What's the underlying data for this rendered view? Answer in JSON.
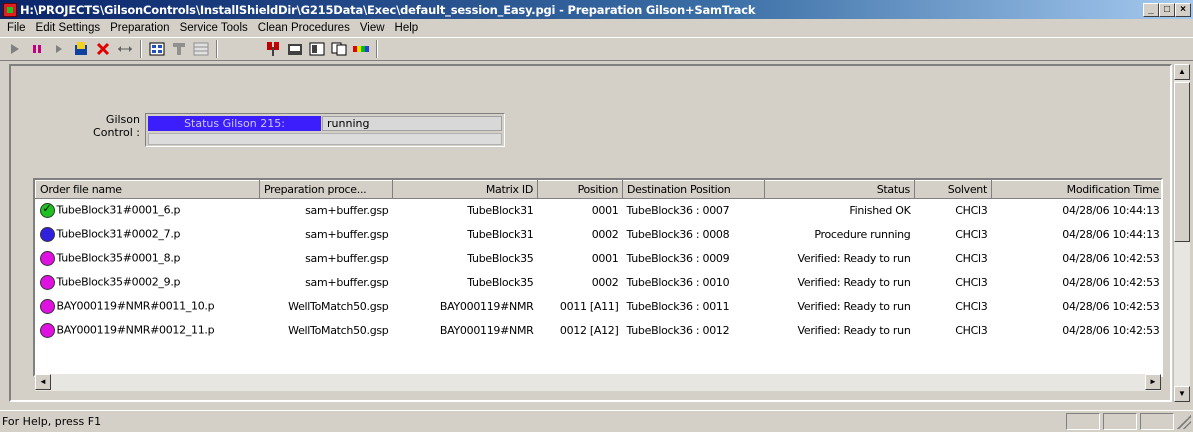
{
  "window": {
    "title": "H:\\PROJECTS\\GilsonControls\\InstallShieldDir\\G215Data\\Exec\\default_session_Easy.pgi - Preparation Gilson+SamTrack",
    "minimize": "_",
    "maximize": "□",
    "close": "×"
  },
  "menu": [
    "File",
    "Edit Settings",
    "Preparation",
    "Service Tools",
    "Clean Procedures",
    "View",
    "Help"
  ],
  "toolbar": {
    "icons": [
      "play-icon",
      "pause-icon",
      "step-icon",
      "save-icon",
      "stop-icon",
      "swap-icon",
      "grid-icon",
      "filter-icon",
      "table-icon",
      "connect-icon",
      "device-icon",
      "panel-icon",
      "copy-icon",
      "color-bar-icon"
    ],
    "colors": {
      "play": "#808080",
      "pause": "#c00080",
      "stop": "#e00000"
    }
  },
  "gilson": {
    "label": "Gilson Control :",
    "status_label": "Status Gilson 215:",
    "status_value": "running",
    "status_color": "#3c1efc"
  },
  "table": {
    "columns": [
      "Order file name",
      "Preparation proce...",
      "Matrix ID",
      "Position",
      "Destination Position",
      "Status",
      "Solvent",
      "Modification Time"
    ],
    "rows": [
      {
        "name": "TubeBlock31#0001_6.p",
        "proc": "sam+buffer.gsp",
        "matrix": "TubeBlock31",
        "pos": "0001",
        "dest": "TubeBlock36 : 0007",
        "status": "Finished OK",
        "solvent": "CHCl3",
        "time": "04/28/06 10:44:13",
        "dot": "#20c020",
        "check": true
      },
      {
        "name": "TubeBlock31#0002_7.p",
        "proc": "sam+buffer.gsp",
        "matrix": "TubeBlock31",
        "pos": "0002",
        "dest": "TubeBlock36 : 0008",
        "status": "Procedure running",
        "solvent": "CHCl3",
        "time": "04/28/06 10:44:13",
        "dot": "#3020e0",
        "check": false
      },
      {
        "name": "TubeBlock35#0001_8.p",
        "proc": "sam+buffer.gsp",
        "matrix": "TubeBlock35",
        "pos": "0001",
        "dest": "TubeBlock36 : 0009",
        "status": "Verified: Ready to run",
        "solvent": "CHCl3",
        "time": "04/28/06 10:42:53",
        "dot": "#e010e0",
        "check": false
      },
      {
        "name": "TubeBlock35#0002_9.p",
        "proc": "sam+buffer.gsp",
        "matrix": "TubeBlock35",
        "pos": "0002",
        "dest": "TubeBlock36 : 0010",
        "status": "Verified: Ready to run",
        "solvent": "CHCl3",
        "time": "04/28/06 10:42:53",
        "dot": "#e010e0",
        "check": false
      },
      {
        "name": "BAY000119#NMR#0011_10.p",
        "proc": "WellToMatch50.gsp",
        "matrix": "BAY000119#NMR",
        "pos": "0011 [A11]",
        "dest": "TubeBlock36 : 0011",
        "status": "Verified: Ready to run",
        "solvent": "CHCl3",
        "time": "04/28/06 10:42:53",
        "dot": "#e010e0",
        "check": false
      },
      {
        "name": "BAY000119#NMR#0012_11.p",
        "proc": "WellToMatch50.gsp",
        "matrix": "BAY000119#NMR",
        "pos": "0012 [A12]",
        "dest": "TubeBlock36 : 0012",
        "status": "Verified: Ready to run",
        "solvent": "CHCl3",
        "time": "04/28/06 10:42:53",
        "dot": "#e010e0",
        "check": false
      }
    ]
  },
  "statusbar": {
    "text": "For Help, press F1"
  }
}
